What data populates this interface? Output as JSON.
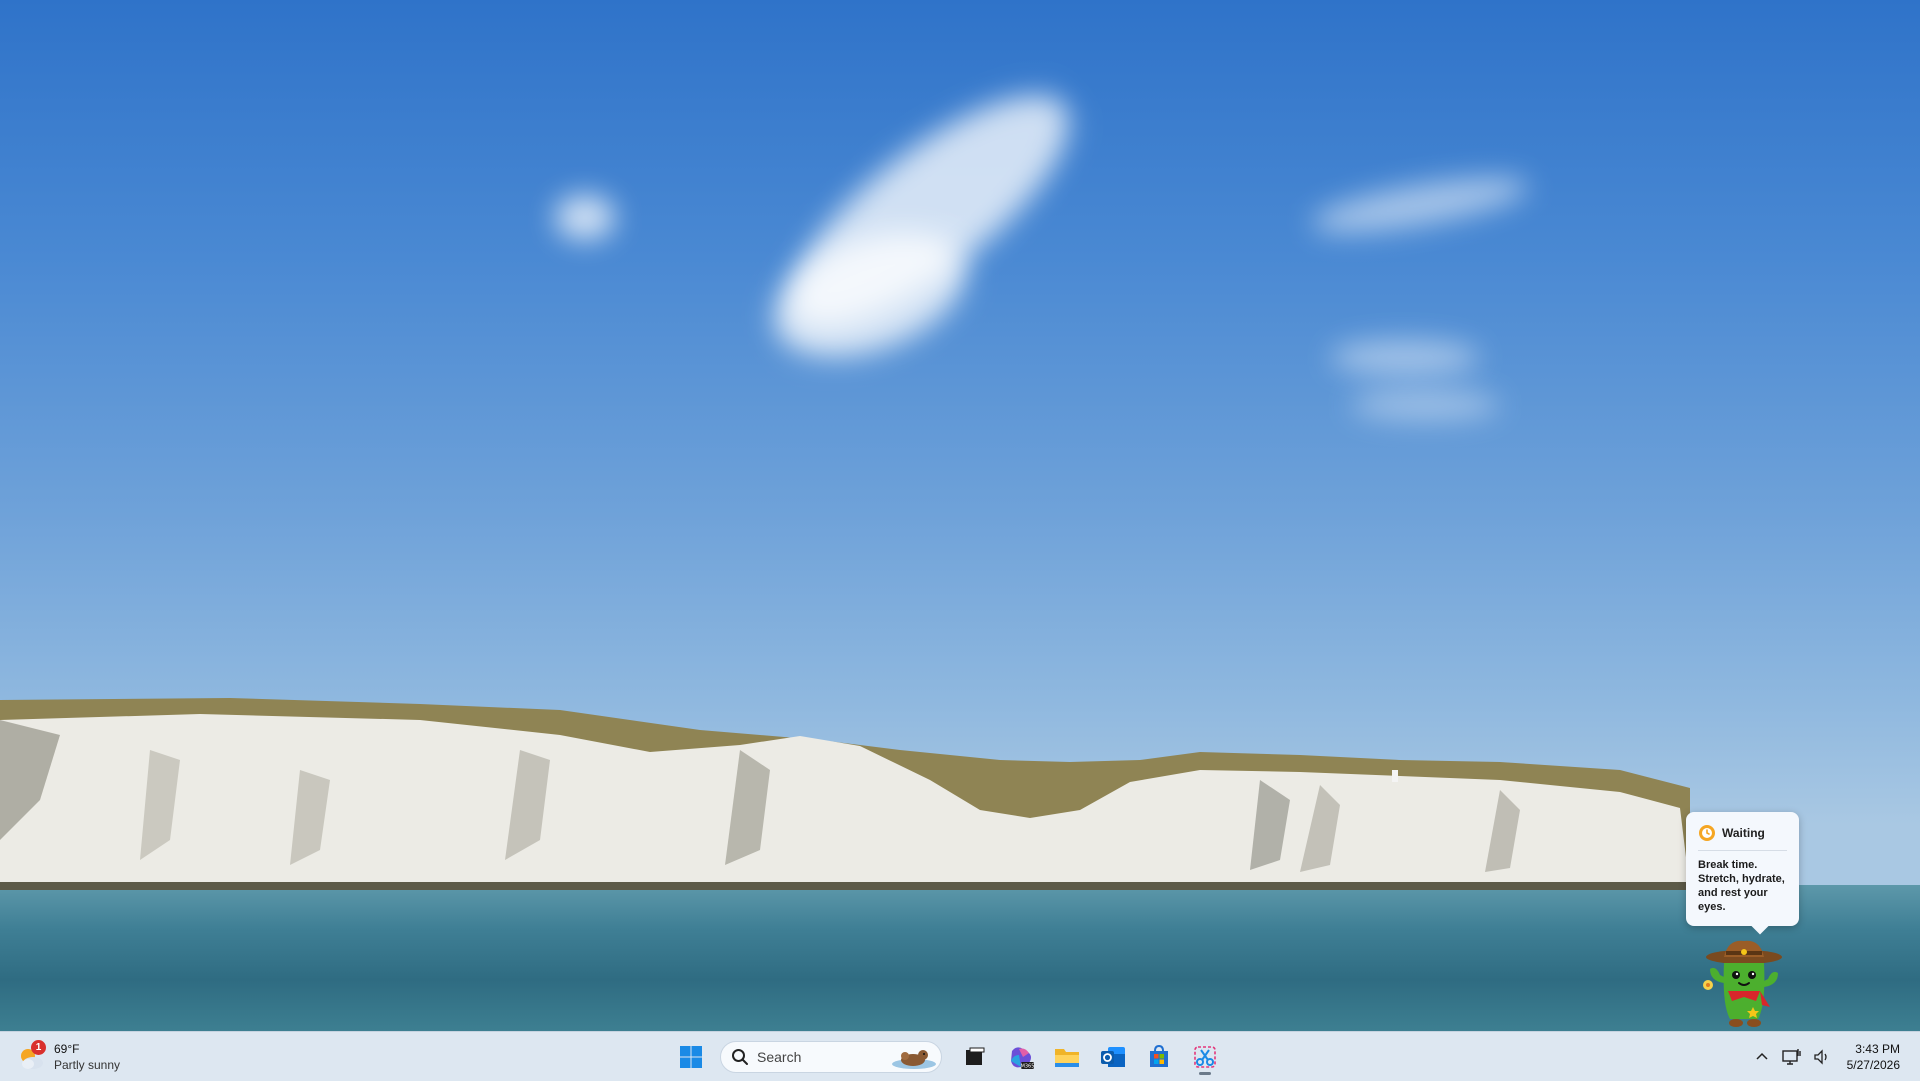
{
  "taskbar": {
    "weather": {
      "temperature": "69°F",
      "condition": "Partly sunny",
      "badge": "1"
    },
    "search": {
      "label": "Search"
    },
    "pinned": [
      {
        "name": "start-button"
      },
      {
        "name": "task-view"
      },
      {
        "name": "microsoft-365-copilot"
      },
      {
        "name": "file-explorer"
      },
      {
        "name": "outlook"
      },
      {
        "name": "microsoft-store"
      },
      {
        "name": "snipping-tool"
      }
    ],
    "clock": {
      "time": "3:43 PM",
      "date": "5/27/2026"
    }
  },
  "pet": {
    "status": "Waiting",
    "message": "Break time. Stretch, hydrate, and rest your eyes."
  },
  "colors": {
    "taskbar_bg": "#dde7f1",
    "accent": "#0078d4",
    "badge": "#d9302d"
  }
}
